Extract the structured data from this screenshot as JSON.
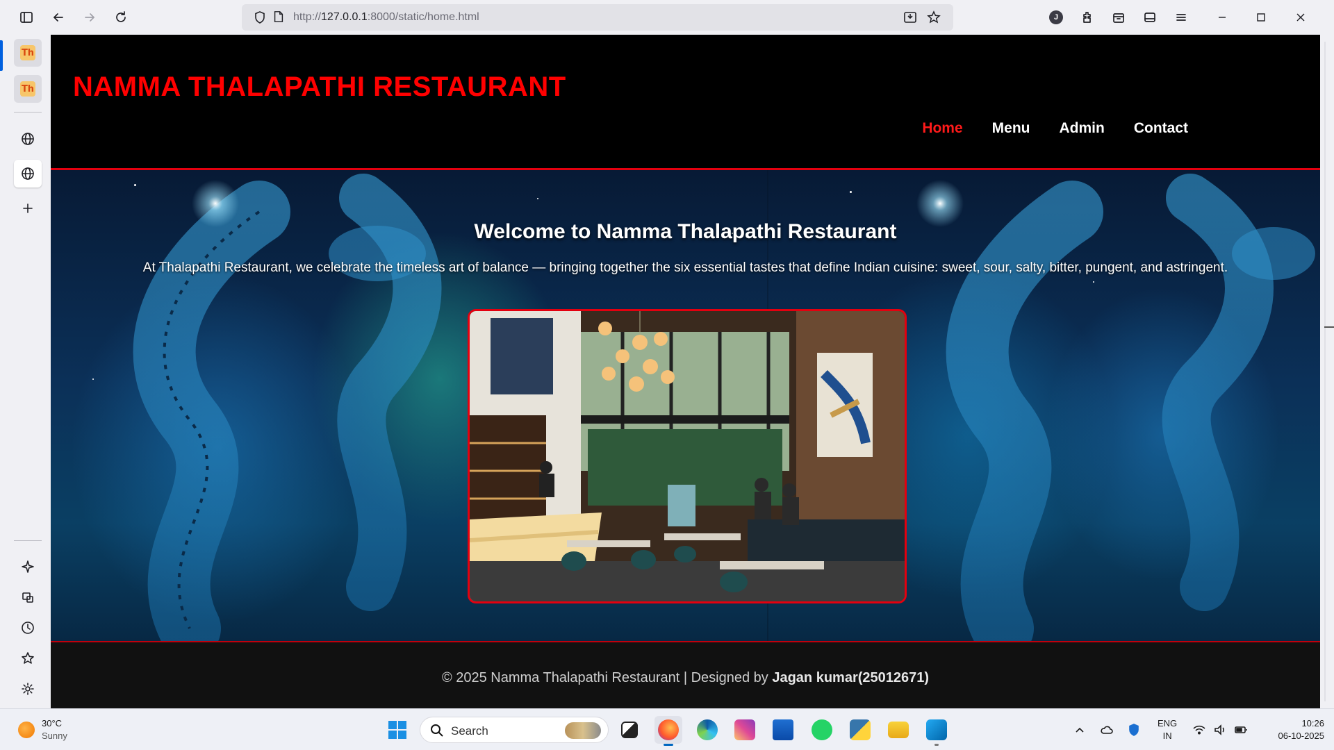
{
  "browser": {
    "url_prefix": "http://",
    "url_host": "127.0.0.1",
    "url_rest": ":8000/static/home.html"
  },
  "sidebar": {
    "tabs": [
      {
        "favicon": "Th"
      },
      {
        "favicon": "Th"
      }
    ]
  },
  "site": {
    "brand": "NAMMA THALAPATHI RESTAURANT",
    "nav": [
      {
        "label": "Home",
        "active": true
      },
      {
        "label": "Menu",
        "active": false
      },
      {
        "label": "Admin",
        "active": false
      },
      {
        "label": "Contact",
        "active": false
      }
    ],
    "hero": {
      "title": "Welcome to Namma Thalapathi Restaurant",
      "text": "At Thalapathi Restaurant, we celebrate the timeless art of balance — bringing together the six essential tastes that define Indian cuisine: sweet, sour, salty, bitter, pungent, and astringent."
    },
    "footer": {
      "copy_prefix": "© 2025 Namma Thalapathi Restaurant | Designed by ",
      "designer": "Jagan kumar(25012671)"
    },
    "colors": {
      "brand_red": "#ff0000",
      "header_bg": "#000000",
      "footer_bg": "#111111"
    }
  },
  "taskbar": {
    "weather": {
      "temp": "30°C",
      "condition": "Sunny"
    },
    "search_label": "Search",
    "lang_top": "ENG",
    "lang_bottom": "IN",
    "time": "10:26",
    "date": "06-10-2025"
  }
}
